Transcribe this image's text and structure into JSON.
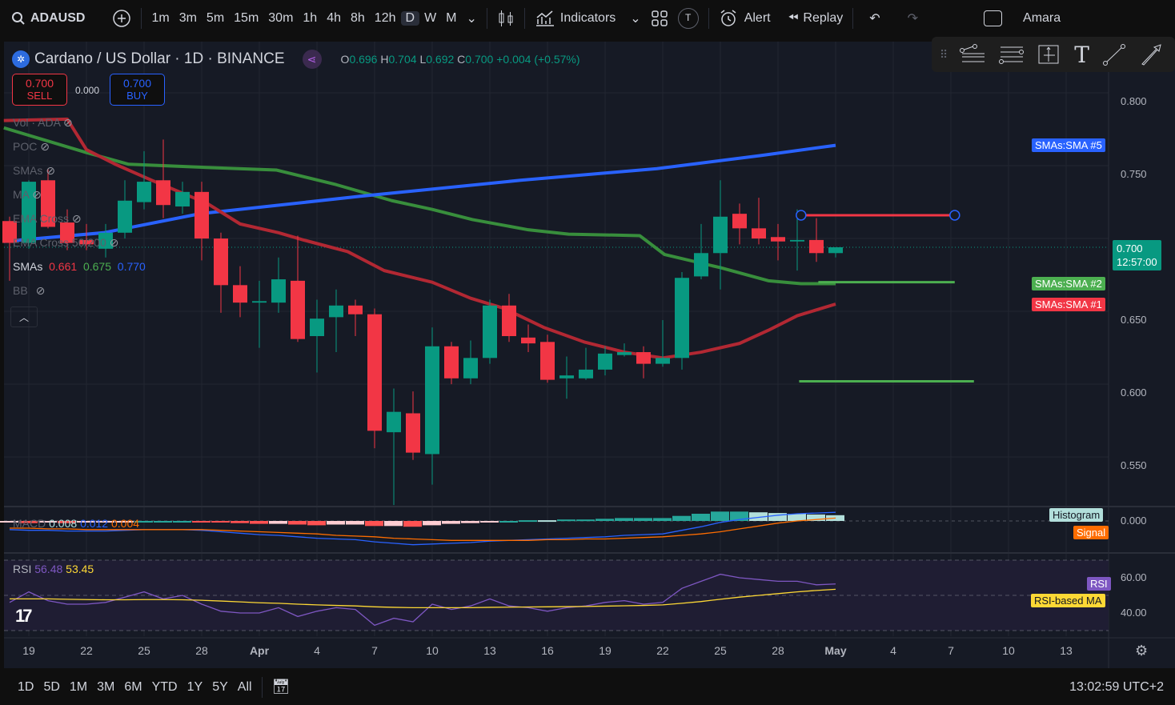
{
  "toolbar": {
    "symbol": "ADAUSD",
    "intervals": [
      "1m",
      "3m",
      "5m",
      "15m",
      "30m",
      "1h",
      "4h",
      "8h",
      "12h",
      "D",
      "W",
      "M"
    ],
    "active_interval": "D",
    "indicators_label": "Indicators",
    "alert_label": "Alert",
    "replay_label": "Replay",
    "user_label": "Amara",
    "template_badge": "T"
  },
  "header": {
    "title": "Cardano / US Dollar · 1D · BINANCE",
    "ohlc": {
      "o_label": "O",
      "o": "0.696",
      "h_label": "H",
      "h": "0.704",
      "l_label": "L",
      "l": "0.692",
      "c_label": "C",
      "c": "0.700",
      "change": "+0.004 (+0.57%)"
    },
    "sell_price": "0.700",
    "sell_label": "SELL",
    "spread": "0.000",
    "buy_price": "0.700",
    "buy_label": "BUY"
  },
  "legend": {
    "items": [
      "Vol · ADA",
      "POC",
      "SMAs",
      "MA",
      "EMA Cross",
      "EMA Cross 50/200"
    ],
    "smas_label": "SMAs",
    "sma1": "0.661",
    "sma2": "0.675",
    "sma3": "0.770",
    "bb_label": "BB",
    "macd_label": "MACD",
    "macd_hist": "0.008",
    "macd_line": "0.012",
    "macd_signal": "0.004",
    "rsi_label": "RSI",
    "rsi_value": "56.48",
    "rsi_ma": "53.45"
  },
  "price_axis": {
    "ticks": [
      "0.800",
      "0.750",
      "0.650",
      "0.600",
      "0.550"
    ],
    "current_price": "0.700",
    "countdown": "12:57:00",
    "macd_tick": "0.000",
    "rsi_ticks": [
      "60.00",
      "40.00"
    ],
    "tags": {
      "sma5": "SMAs:SMA #5",
      "sma2": "SMAs:SMA #2",
      "sma1": "SMAs:SMA #1",
      "histogram": "Histogram",
      "signal": "Signal",
      "rsi": "RSI",
      "rsi_ma": "RSI-based MA"
    }
  },
  "time_axis": [
    "19",
    "22",
    "25",
    "28",
    "Apr",
    "4",
    "7",
    "10",
    "13",
    "16",
    "19",
    "22",
    "25",
    "28",
    "May",
    "4",
    "7",
    "10",
    "13"
  ],
  "bottombar": {
    "ranges": [
      "1D",
      "5D",
      "1M",
      "3M",
      "6M",
      "YTD",
      "1Y",
      "5Y",
      "All"
    ],
    "clock": "13:02:59 UTC+2"
  },
  "colors": {
    "up": "#089981",
    "down": "#f23645",
    "sma1": "#b22833",
    "sma2": "#388e3c",
    "sma5": "#2962ff",
    "macd": "#2962ff",
    "signal": "#ff6d00",
    "rsi": "#7e57c2",
    "rsi_ma": "#fdd835"
  },
  "chart_data": {
    "type": "candlestick",
    "first_date": "Mar 18",
    "candles": [
      [
        0.718,
        0.721,
        0.677,
        0.703
      ],
      [
        0.703,
        0.746,
        0.699,
        0.745
      ],
      [
        0.746,
        0.754,
        0.713,
        0.714
      ],
      [
        0.717,
        0.726,
        0.698,
        0.703
      ],
      [
        0.705,
        0.716,
        0.698,
        0.702
      ],
      [
        0.699,
        0.716,
        0.693,
        0.71
      ],
      [
        0.71,
        0.746,
        0.706,
        0.732
      ],
      [
        0.731,
        0.766,
        0.726,
        0.745
      ],
      [
        0.746,
        0.774,
        0.72,
        0.729
      ],
      [
        0.728,
        0.745,
        0.723,
        0.738
      ],
      [
        0.738,
        0.745,
        0.691,
        0.706
      ],
      [
        0.706,
        0.71,
        0.655,
        0.674
      ],
      [
        0.674,
        0.687,
        0.652,
        0.662
      ],
      [
        0.662,
        0.677,
        0.631,
        0.663
      ],
      [
        0.662,
        0.693,
        0.655,
        0.678
      ],
      [
        0.677,
        0.708,
        0.635,
        0.637
      ],
      [
        0.639,
        0.664,
        0.614,
        0.651
      ],
      [
        0.652,
        0.671,
        0.628,
        0.66
      ],
      [
        0.66,
        0.664,
        0.639,
        0.654
      ],
      [
        0.654,
        0.658,
        0.562,
        0.574
      ],
      [
        0.573,
        0.603,
        0.523,
        0.587
      ],
      [
        0.586,
        0.601,
        0.554,
        0.559
      ],
      [
        0.558,
        0.645,
        0.537,
        0.632
      ],
      [
        0.632,
        0.635,
        0.606,
        0.61
      ],
      [
        0.61,
        0.636,
        0.606,
        0.624
      ],
      [
        0.624,
        0.664,
        0.62,
        0.66
      ],
      [
        0.66,
        0.668,
        0.635,
        0.639
      ],
      [
        0.638,
        0.647,
        0.628,
        0.634
      ],
      [
        0.635,
        0.64,
        0.607,
        0.609
      ],
      [
        0.61,
        0.625,
        0.596,
        0.612
      ],
      [
        0.61,
        0.631,
        0.609,
        0.616
      ],
      [
        0.616,
        0.632,
        0.612,
        0.627
      ],
      [
        0.626,
        0.634,
        0.625,
        0.628
      ],
      [
        0.628,
        0.632,
        0.61,
        0.62
      ],
      [
        0.62,
        0.65,
        0.618,
        0.624
      ],
      [
        0.624,
        0.683,
        0.616,
        0.679
      ],
      [
        0.68,
        0.716,
        0.678,
        0.696
      ],
      [
        0.696,
        0.746,
        0.671,
        0.721
      ],
      [
        0.723,
        0.73,
        0.702,
        0.713
      ],
      [
        0.713,
        0.734,
        0.702,
        0.706
      ],
      [
        0.707,
        0.716,
        0.691,
        0.704
      ],
      [
        0.704,
        0.726,
        0.684,
        0.705
      ],
      [
        0.705,
        0.72,
        0.69,
        0.696
      ],
      [
        0.696,
        0.7,
        0.693,
        0.7
      ]
    ],
    "sma1": [
      [
        -0.3,
        0.787
      ],
      [
        3,
        0.788
      ],
      [
        4,
        0.767
      ],
      [
        5.5,
        0.757
      ],
      [
        7.4,
        0.746
      ],
      [
        10.3,
        0.73
      ],
      [
        12,
        0.716
      ],
      [
        14,
        0.71
      ],
      [
        15.3,
        0.705
      ],
      [
        17.6,
        0.697
      ],
      [
        19.5,
        0.684
      ],
      [
        22,
        0.676
      ],
      [
        24,
        0.665
      ],
      [
        25.75,
        0.658
      ],
      [
        27.8,
        0.645
      ],
      [
        29.9,
        0.635
      ],
      [
        32,
        0.628
      ],
      [
        34,
        0.624
      ],
      [
        36,
        0.628
      ],
      [
        38,
        0.634
      ],
      [
        39.5,
        0.643
      ],
      [
        41,
        0.653
      ],
      [
        43,
        0.661
      ]
    ],
    "sma2": [
      [
        -0.3,
        0.782
      ],
      [
        4,
        0.765
      ],
      [
        6.2,
        0.757
      ],
      [
        9.9,
        0.755
      ],
      [
        13.9,
        0.753
      ],
      [
        17,
        0.743
      ],
      [
        19.9,
        0.732
      ],
      [
        22,
        0.726
      ],
      [
        24.1,
        0.719
      ],
      [
        27,
        0.712
      ],
      [
        29.1,
        0.709
      ],
      [
        32.8,
        0.708
      ],
      [
        34.1,
        0.695
      ],
      [
        37,
        0.686
      ],
      [
        39.5,
        0.677
      ],
      [
        41.2,
        0.675
      ],
      [
        43,
        0.675
      ]
    ],
    "sma5": [
      [
        -0.3,
        0.704
      ],
      [
        4.9,
        0.71
      ],
      [
        9.9,
        0.723
      ],
      [
        18.25,
        0.735
      ],
      [
        26.6,
        0.746
      ],
      [
        33.7,
        0.754
      ],
      [
        39.1,
        0.763
      ],
      [
        43,
        0.77
      ]
    ],
    "drawings": [
      {
        "type": "horizontal-ray",
        "price": 0.722,
        "from": 41.2,
        "to": 49.2,
        "color": "#f23645"
      },
      {
        "type": "horizontal-line",
        "price": 0.676,
        "from": 42.1,
        "to": 49.2,
        "color": "#4caf50"
      },
      {
        "type": "horizontal-line",
        "price": 0.608,
        "from": 41.1,
        "to": 50.2,
        "color": "#4caf50"
      }
    ],
    "macd": {
      "macd": [
        -0.012,
        -0.013,
        -0.013,
        -0.014,
        -0.014,
        -0.014,
        -0.013,
        -0.012,
        -0.012,
        -0.012,
        -0.013,
        -0.015,
        -0.017,
        -0.019,
        -0.02,
        -0.022,
        -0.024,
        -0.025,
        -0.026,
        -0.029,
        -0.031,
        -0.033,
        -0.032,
        -0.031,
        -0.03,
        -0.028,
        -0.027,
        -0.026,
        -0.025,
        -0.024,
        -0.023,
        -0.022,
        -0.02,
        -0.019,
        -0.018,
        -0.013,
        -0.008,
        -0.002,
        0.002,
        0.005,
        0.008,
        0.01,
        0.011,
        0.012
      ],
      "signal": [
        -0.01,
        -0.01,
        -0.011,
        -0.011,
        -0.012,
        -0.012,
        -0.012,
        -0.012,
        -0.012,
        -0.012,
        -0.012,
        -0.013,
        -0.014,
        -0.015,
        -0.016,
        -0.017,
        -0.018,
        -0.02,
        -0.021,
        -0.022,
        -0.024,
        -0.025,
        -0.026,
        -0.027,
        -0.027,
        -0.027,
        -0.027,
        -0.027,
        -0.026,
        -0.026,
        -0.025,
        -0.025,
        -0.024,
        -0.023,
        -0.022,
        -0.02,
        -0.018,
        -0.015,
        -0.011,
        -0.007,
        -0.003,
        0.0,
        0.002,
        0.004
      ]
    },
    "rsi": {
      "rsi": [
        46,
        52,
        47,
        45,
        45,
        46,
        49,
        52,
        48,
        50,
        45,
        41,
        40,
        40,
        43,
        38,
        41,
        43,
        42,
        33,
        37,
        35,
        45,
        42,
        44,
        48,
        44,
        43,
        41,
        43,
        44,
        46,
        47,
        45,
        46,
        54,
        58,
        62,
        60,
        59,
        58,
        58,
        56,
        56.48
      ],
      "ma": [
        48,
        48,
        48,
        47.8,
        47.6,
        47.5,
        47.5,
        47.6,
        47.6,
        47.5,
        47.2,
        46.8,
        46.3,
        45.8,
        45.5,
        45,
        44.6,
        44.3,
        44,
        43.5,
        43.2,
        43,
        43,
        43,
        43,
        43.2,
        43.3,
        43.4,
        43.5,
        43.6,
        43.7,
        43.9,
        44.1,
        44.3,
        44.6,
        45.5,
        46.5,
        47.8,
        49,
        50,
        51,
        52,
        52.8,
        53.45
      ]
    }
  }
}
